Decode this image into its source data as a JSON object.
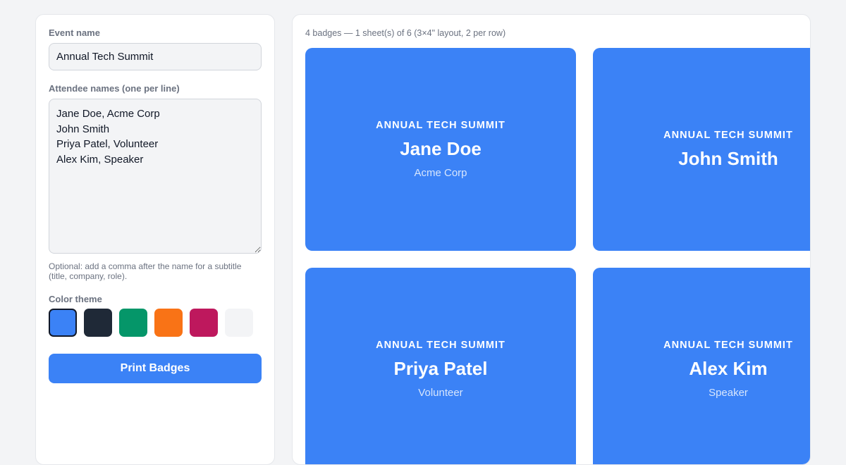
{
  "form": {
    "event_label": "Event name",
    "event_value": "Annual Tech Summit",
    "names_label": "Attendee names (one per line)",
    "names_value": "Jane Doe, Acme Corp\nJohn Smith\nPriya Patel, Volunteer\nAlex Kim, Speaker",
    "hint": "Optional: add a comma after the name for a subtitle (title, company, role).",
    "theme_label": "Color theme",
    "themes": [
      {
        "name": "blue",
        "color": "#3b82f6",
        "selected": true
      },
      {
        "name": "navy",
        "color": "#1f2937",
        "selected": false
      },
      {
        "name": "green",
        "color": "#059669",
        "selected": false
      },
      {
        "name": "orange",
        "color": "#f97316",
        "selected": false
      },
      {
        "name": "magenta",
        "color": "#be185d",
        "selected": false
      },
      {
        "name": "light",
        "color": "#f3f4f6",
        "selected": false
      }
    ],
    "print_label": "Print Badges"
  },
  "preview": {
    "summary": "4 badges — 1 sheet(s) of 6 (3×4\" layout, 2 per row)",
    "badge_color": "#3b82f6",
    "badges": [
      {
        "event": "ANNUAL TECH SUMMIT",
        "name": "Jane Doe",
        "subtitle": "Acme Corp"
      },
      {
        "event": "ANNUAL TECH SUMMIT",
        "name": "John Smith",
        "subtitle": ""
      },
      {
        "event": "ANNUAL TECH SUMMIT",
        "name": "Priya Patel",
        "subtitle": "Volunteer"
      },
      {
        "event": "ANNUAL TECH SUMMIT",
        "name": "Alex Kim",
        "subtitle": "Speaker"
      }
    ]
  }
}
